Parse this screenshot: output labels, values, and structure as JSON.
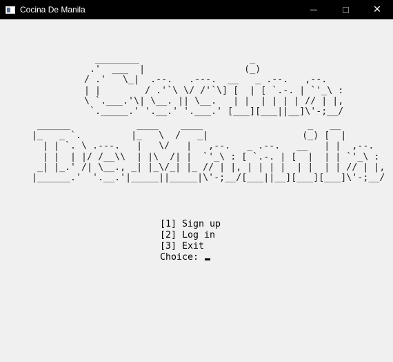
{
  "window": {
    "title": "Cocina De Manila",
    "controls": {
      "minimize": "—",
      "maximize": "☐",
      "close": "✕"
    }
  },
  "console": {
    "banner_line1": "    ________                    _\n   .'  ___  |                  (_)\n  / .'   \\_|  .--.   .---.  __   _ .--.   ,--.\n  | |        / .'`\\ \\/ /'`\\] [  | [ `.-. | `'_\\ :\n  \\ `.___.'\\| \\__. || \\__.   | |  | | | | // | |,\n   `._____.' '.__.' '.___.' [___][___||__]\\'-;__/",
    "banner_line2": " ______            ____    ____                   _   __\n|_   _ `.         |_   \\  /   _|                 (_) [  |\n  | | `. \\ .---.   |   \\/   |   ,--.   _ .--.   __   | |  ,--.\n  | |  | |/ /__\\\\  | |\\  /| |  `'_\\ : [ `.-. | [  |  | | `'_\\ :\n _| |_.' /| \\__., _| |_\\/_| |_ // | |, | | | |  | |  | | // | |,\n|______.'  '.__.'|_____||_____|\\'-;__/[___||__][___][___]\\'-;__/",
    "menu": [
      {
        "label": "[1] Sign up"
      },
      {
        "label": "[2] Log in"
      },
      {
        "label": "[3] Exit"
      }
    ],
    "prompt": "Choice: "
  }
}
